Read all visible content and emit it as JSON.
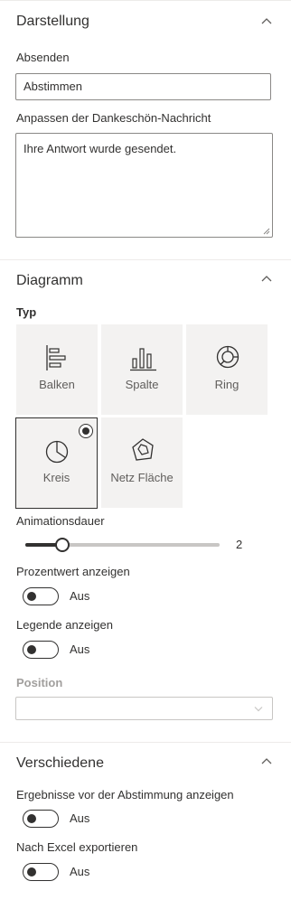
{
  "darstellung": {
    "title": "Darstellung",
    "submit_label": "Absenden",
    "submit_value": "Abstimmen",
    "thanks_label": "Anpassen der Dankeschön-Nachricht",
    "thanks_value": "Ihre Antwort wurde gesendet."
  },
  "diagramm": {
    "title": "Diagramm",
    "type_label": "Typ",
    "types": [
      {
        "label": "Balken",
        "icon": "bar-chart-icon",
        "selected": false
      },
      {
        "label": "Spalte",
        "icon": "column-chart-icon",
        "selected": false
      },
      {
        "label": "Ring",
        "icon": "donut-chart-icon",
        "selected": false
      },
      {
        "label": "Kreis",
        "icon": "pie-chart-icon",
        "selected": true
      },
      {
        "label": "Netz Fläche",
        "icon": "radar-chart-icon",
        "selected": false
      }
    ],
    "animation_label": "Animationsdauer",
    "animation_value": "2",
    "percent_label": "Prozentwert anzeigen",
    "percent_state": "Aus",
    "legend_label": "Legende anzeigen",
    "legend_state": "Aus",
    "position_label": "Position",
    "position_value": ""
  },
  "verschiedene": {
    "title": "Verschiedene",
    "results_label": "Ergebnisse vor der Abstimmung anzeigen",
    "results_state": "Aus",
    "excel_label": "Nach Excel exportieren",
    "excel_state": "Aus"
  }
}
